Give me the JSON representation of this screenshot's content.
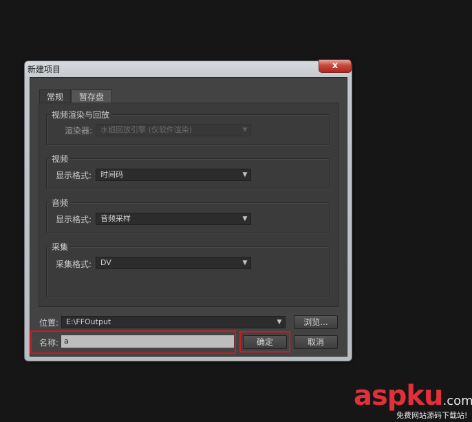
{
  "window": {
    "title": "新建项目",
    "close_glyph": "x"
  },
  "tabs": [
    {
      "label": "常规",
      "active": true
    },
    {
      "label": "暂存盘",
      "active": false
    }
  ],
  "groups": {
    "render": {
      "title": "视频渲染与回放",
      "label": "渲染器:",
      "value": "水银回放引擎 (仅软件渲染)",
      "disabled": true
    },
    "video": {
      "title": "视频",
      "label": "显示格式:",
      "value": "时间码"
    },
    "audio": {
      "title": "音频",
      "label": "显示格式:",
      "value": "音频采样"
    },
    "capture": {
      "title": "采集",
      "label": "采集格式:",
      "value": "DV"
    }
  },
  "location": {
    "label": "位置:",
    "value": "E:\\FFOutput",
    "browse_label": "浏览..."
  },
  "name": {
    "label": "名称:",
    "value": "a"
  },
  "buttons": {
    "ok": "确定",
    "cancel": "取消"
  },
  "watermark": {
    "brand": "aspku",
    "tld": ".com",
    "tagline": "免费网站源码下载站!"
  },
  "colors": {
    "highlight": "#d1181f",
    "watermark": "#e1303a",
    "dialog_bg": "#3b3b3b"
  }
}
